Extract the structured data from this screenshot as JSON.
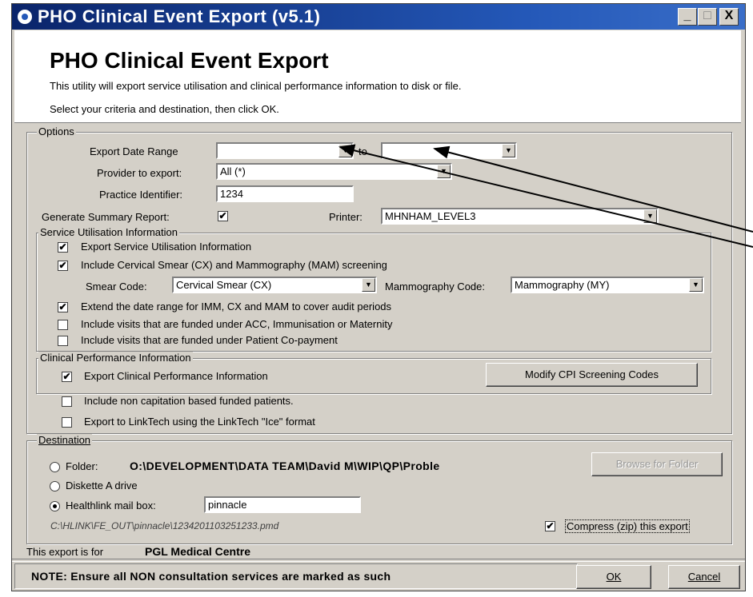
{
  "window": {
    "title": "PHO Clinical Event Export  (v5.1)",
    "minimize_glyph": "_",
    "maximize_glyph": "□",
    "close_glyph": "X"
  },
  "header": {
    "title": "PHO Clinical Event Export",
    "description": "This utility will export service utilisation and clinical performance information to disk or file.",
    "instruction": "Select your criteria and destination, then click OK."
  },
  "options": {
    "group_label": "Options",
    "date_range_label": "Export Date Range",
    "date_from": "",
    "to_label": "to",
    "date_to": "",
    "provider_label": "Provider to export:",
    "provider_value": "All (*)",
    "practice_label": "Practice Identifier:",
    "practice_value": "1234",
    "summary_label": "Generate Summary Report:",
    "summary_checked": true,
    "printer_label": "Printer:",
    "printer_value": "MHNHAM_LEVEL3"
  },
  "service": {
    "group_label": "Service Utilisation Information",
    "export_label": "Export Service Utilisation Information",
    "export_checked": true,
    "cervical_label": "Include Cervical Smear (CX) and Mammography (MAM) screening",
    "cervical_checked": true,
    "smear_code_label": "Smear Code:",
    "smear_code_value": "Cervical Smear (CX)",
    "mammo_code_label": "Mammography Code:",
    "mammo_code_value": "Mammography (MY)",
    "extend_label": "Extend the date range for IMM, CX and MAM to cover audit periods",
    "extend_checked": true,
    "acc_label": "Include visits that are funded under ACC, Immunisation or Maternity",
    "acc_checked": false,
    "copay_label": "Include visits that are funded under Patient Co-payment",
    "copay_checked": false
  },
  "clinical": {
    "group_label": "Clinical Performance Information",
    "export_label": "Export Clinical Performance Information",
    "export_checked": true,
    "modify_button": "Modify CPI Screening Codes"
  },
  "extra": {
    "noncap_label": "Include non capitation based funded patients.",
    "noncap_checked": false,
    "linktech_label": "Export to LinkTech using the LinkTech \"Ice\" format",
    "linktech_checked": false
  },
  "destination": {
    "group_label": "Destination",
    "folder_label": "Folder:",
    "folder_path": "O:\\DEVELOPMENT\\DATA TEAM\\David M\\WIP\\QP\\Proble",
    "browse_button": "Browse for Folder",
    "diskette_label": "Diskette A drive",
    "healthlink_label": "Healthlink mail box:",
    "healthlink_value": "pinnacle",
    "selected": "healthlink",
    "output_path": "C:\\HLINK\\FE_OUT\\pinnacle\\1234201103251233.pmd",
    "compress_label": "Compress (zip) this export",
    "compress_checked": true
  },
  "footer": {
    "export_for_label": "This export is for",
    "practice_name": "PGL Medical Centre",
    "note": "NOTE: Ensure all NON consultation services are marked as such",
    "ok_button": "OK",
    "cancel_button": "Cancel"
  },
  "icons": {
    "dropdown": "▼",
    "check": "✔"
  },
  "colors": {
    "titlebar": "#0a246a",
    "face": "#d4d0c8"
  }
}
